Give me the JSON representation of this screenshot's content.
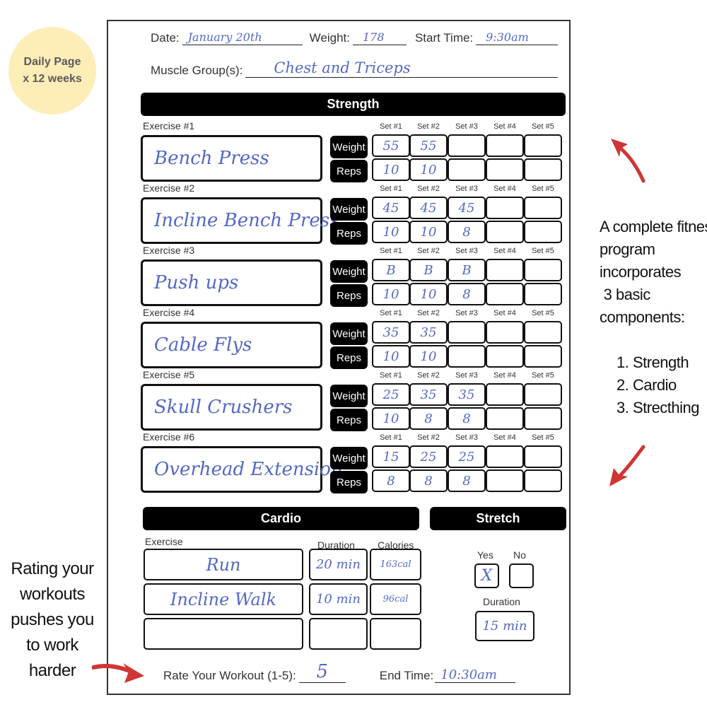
{
  "badge": {
    "line1": "Daily Page",
    "line2": "x 12 weeks",
    "color": "#fdeeb8"
  },
  "header": {
    "date_label": "Date:",
    "date_value": "January 20th",
    "weight_label": "Weight:",
    "weight_value": "178",
    "start_label": "Start Time:",
    "start_value": "9:30am",
    "muscle_label": "Muscle Group(s):",
    "muscle_value": "Chest and Triceps"
  },
  "strength": {
    "title": "Strength",
    "weight_tag": "Weight",
    "reps_tag": "Reps",
    "set_headers": [
      "Set #1",
      "Set #2",
      "Set #3",
      "Set #4",
      "Set #5"
    ],
    "exercises": [
      {
        "label": "Exercise #1",
        "name": "Bench Press",
        "weight": [
          "55",
          "55",
          "",
          "",
          ""
        ],
        "reps": [
          "10",
          "10",
          "",
          "",
          ""
        ]
      },
      {
        "label": "Exercise #2",
        "name": "Incline Bench Press",
        "weight": [
          "45",
          "45",
          "45",
          "",
          ""
        ],
        "reps": [
          "10",
          "10",
          "8",
          "",
          ""
        ]
      },
      {
        "label": "Exercise #3",
        "name": "Push ups",
        "weight": [
          "B",
          "B",
          "B",
          "",
          ""
        ],
        "reps": [
          "10",
          "10",
          "8",
          "",
          ""
        ]
      },
      {
        "label": "Exercise #4",
        "name": "Cable Flys",
        "weight": [
          "35",
          "35",
          "",
          "",
          ""
        ],
        "reps": [
          "10",
          "10",
          "",
          "",
          ""
        ]
      },
      {
        "label": "Exercise #5",
        "name": "Skull Crushers",
        "weight": [
          "25",
          "35",
          "35",
          "",
          ""
        ],
        "reps": [
          "10",
          "8",
          "8",
          "",
          ""
        ]
      },
      {
        "label": "Exercise #6",
        "name": "Overhead Extension",
        "weight": [
          "15",
          "25",
          "25",
          "",
          ""
        ],
        "reps": [
          "8",
          "8",
          "8",
          "",
          ""
        ]
      }
    ]
  },
  "cardio": {
    "title": "Cardio",
    "exercise_header": "Exercise",
    "duration_header": "Duration",
    "calories_header": "Calories",
    "rows": [
      {
        "exercise": "Run",
        "duration": "20 min",
        "calories": "163cal"
      },
      {
        "exercise": "Incline Walk",
        "duration": "10 min",
        "calories": "96cal"
      },
      {
        "exercise": "",
        "duration": "",
        "calories": ""
      }
    ]
  },
  "stretch": {
    "title": "Stretch",
    "yes_label": "Yes",
    "no_label": "No",
    "yes_mark": "X",
    "no_mark": "",
    "duration_label": "Duration",
    "duration_value": "15 min"
  },
  "footer": {
    "rate_label": "Rate Your Workout (1-5):",
    "rate_value": "5",
    "end_label": "End Time:",
    "end_value": "10:30am"
  },
  "annotations": {
    "right_text": [
      "A complete fitness",
      "program",
      "incorporates",
      " 3 basic",
      "components:"
    ],
    "right_list": [
      "1. Strength",
      "2. Cardio",
      "3. Strecthing"
    ],
    "left_text": [
      "Rating your",
      "workouts",
      "pushes you",
      "to work",
      "harder"
    ],
    "arrow_color": "#d03535"
  }
}
